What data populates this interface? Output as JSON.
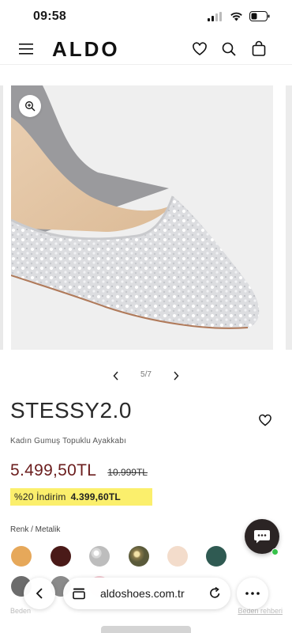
{
  "status_bar": {
    "time": "09:58"
  },
  "header": {
    "logo_text": "ALDO",
    "icons": [
      "menu-icon",
      "heart-icon",
      "search-icon",
      "bag-icon"
    ]
  },
  "gallery": {
    "pager_text": "5/7",
    "zoom_icon": "zoom-in-icon"
  },
  "product": {
    "title": "STESSY2.0",
    "subtitle": "Kadın Gumuş Topuklu Ayakkabı",
    "price_sale": "5.499,50TL",
    "price_old": "10.999TL",
    "discount_label": "%20 İndirim",
    "discount_value": "4.399,60TL",
    "color_label": "Renk  /  Metalik"
  },
  "swatches": [
    {
      "name": "camel",
      "color": "#e6a85a"
    },
    {
      "name": "burgundy",
      "color": "#4a1a18"
    },
    {
      "name": "silver-crystal",
      "color": "#cfcfcf"
    },
    {
      "name": "gold-crystal",
      "color": "#b59a5a"
    },
    {
      "name": "nude",
      "color": "#f3dccb"
    },
    {
      "name": "teal",
      "color": "#2f5a52"
    },
    {
      "name": "grey",
      "color": "#6c6c6c"
    },
    {
      "name": "pewter",
      "color": "#8a8a8a"
    },
    {
      "name": "pink",
      "color": "#f4c9d2"
    }
  ],
  "footer": {
    "left_text": "Beden",
    "right_text": "Beden rehberi"
  },
  "browser": {
    "url": "aldoshoes.com.tr"
  },
  "colors": {
    "sale_price": "#6b1d1d",
    "discount_bg": "#fbef6c",
    "chat_fab": "#2b2424",
    "online_dot": "#36c24a"
  }
}
